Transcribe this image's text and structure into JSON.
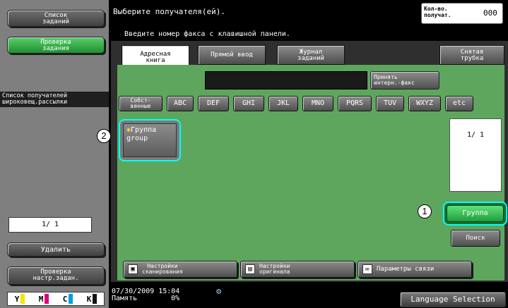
{
  "sidebar": {
    "job_list_label": "Список\nзаданий",
    "check_job_label": "Проверка\nзадания",
    "broadcast_list_label": "Список получателей\nшироковещ.рассылки",
    "page_counter": "1/ 1",
    "delete_label": "Удалить",
    "check_settings_label": "Проверка\nнастр.задан.",
    "toner": [
      {
        "letter": "Y",
        "color": "#f2e600"
      },
      {
        "letter": "M",
        "color": "#e0007a"
      },
      {
        "letter": "C",
        "color": "#00a0e0"
      },
      {
        "letter": "K",
        "color": "#111111"
      }
    ]
  },
  "header": {
    "prompt": "Выберите получателя(ей).",
    "instruction": "Введите номер факса с клавишной панели.",
    "recipient_count_label": "Кол-во.\nполучат.",
    "recipient_count_value": "000"
  },
  "tabs": [
    {
      "label": "Адресная\nкнига",
      "active": true
    },
    {
      "label": "Прямой ввод",
      "active": false
    },
    {
      "label": "Журнал\nзаданий",
      "active": false
    },
    {
      "label": "Снятая\nтрубка",
      "active": false
    }
  ],
  "internet_fax_label": "Принять\nинтерн.-факс",
  "index_keys": [
    "Собст-\nвенные",
    "ABC",
    "DEF",
    "GHI",
    "JKL",
    "MNO",
    "PQRS",
    "TUV",
    "WXYZ",
    "etc"
  ],
  "entry": {
    "type_label": "Группа",
    "name": "group"
  },
  "callouts": {
    "entry": "2",
    "group_button": "1"
  },
  "list_page": "1/ 1",
  "group_button_label": "Группа",
  "search_button_label": "Поиск",
  "bottom_buttons": {
    "scan_settings": "Настройки\nсканирования",
    "original_settings": "Настройки\nоригинала",
    "comm_settings": "Параметры связи"
  },
  "status": {
    "datetime": "07/30/2009   15:04",
    "memory_label": "Память",
    "memory_value": "0%"
  },
  "language_button": "Language Selection"
}
